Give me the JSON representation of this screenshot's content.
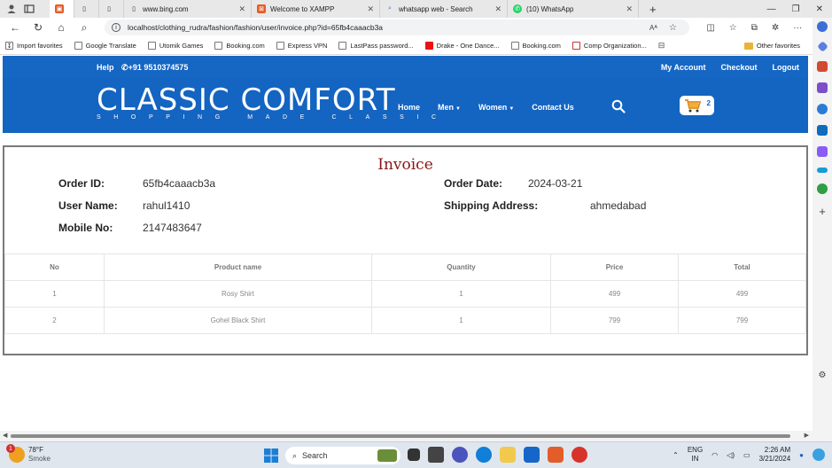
{
  "browser": {
    "tabs": [
      {
        "title": "",
        "active": true,
        "color": "#e35d2a"
      },
      {
        "title": "",
        "active": false,
        "color": "#888888"
      },
      {
        "title": "",
        "active": false,
        "color": "#888888"
      },
      {
        "title": "www.bing.com",
        "active": false,
        "color": "#555555"
      },
      {
        "title": "Welcome to XAMPP",
        "active": false,
        "color": "#e35d2a"
      },
      {
        "title": "whatsapp web - Search",
        "active": false,
        "color": "#3c6fd6"
      },
      {
        "title": "(10) WhatsApp",
        "active": false,
        "color": "#25d366"
      }
    ],
    "url": "localhost/clothing_rudra/fashion/fashion/user/invoice.php?id=65fb4caaacb3a",
    "favorites": [
      "Import favorites",
      "Google Translate",
      "Utomik Games",
      "Booking.com",
      "Express VPN",
      "LastPass password...",
      "Drake - One Dance...",
      "Booking.com",
      "Comp Organization..."
    ],
    "other_favorites": "Other favorites"
  },
  "site": {
    "help": "Help",
    "phone": "+91 9510374575",
    "account_links": [
      "My Account",
      "Checkout",
      "Logout"
    ],
    "logo_title": "CLASSIC COMFORT",
    "logo_tagline": "SHOPPING MADE CLASSIC",
    "menu": {
      "home": "Home",
      "men": "Men",
      "women": "Women",
      "contact": "Contact Us"
    },
    "cart_count": "2",
    "brand_color": "#1464c1"
  },
  "invoice": {
    "title": "Invoice",
    "order_id_label": "Order ID:",
    "order_id": "65fb4caaacb3a",
    "order_date_label": "Order Date:",
    "order_date": "2024-03-21",
    "user_name_label": "User Name:",
    "user_name": "rahul1410",
    "shipping_label": "Shipping Address:",
    "shipping_address": "ahmedabad",
    "mobile_label": "Mobile No:",
    "mobile": "2147483647",
    "columns": [
      "No",
      "Product name",
      "Quantity",
      "Price",
      "Total"
    ],
    "rows": [
      [
        "1",
        "Rosy Shirt",
        "1",
        "499",
        "499"
      ],
      [
        "2",
        "Gohel Black Shirt",
        "1",
        "799",
        "799"
      ]
    ]
  },
  "taskbar": {
    "weather_temp": "78°F",
    "weather_desc": "Smoke",
    "weather_badge": "1",
    "search_placeholder": "Search",
    "lang": "ENG",
    "region": "IN",
    "time": "2:26 AM",
    "date": "3/21/2024"
  }
}
